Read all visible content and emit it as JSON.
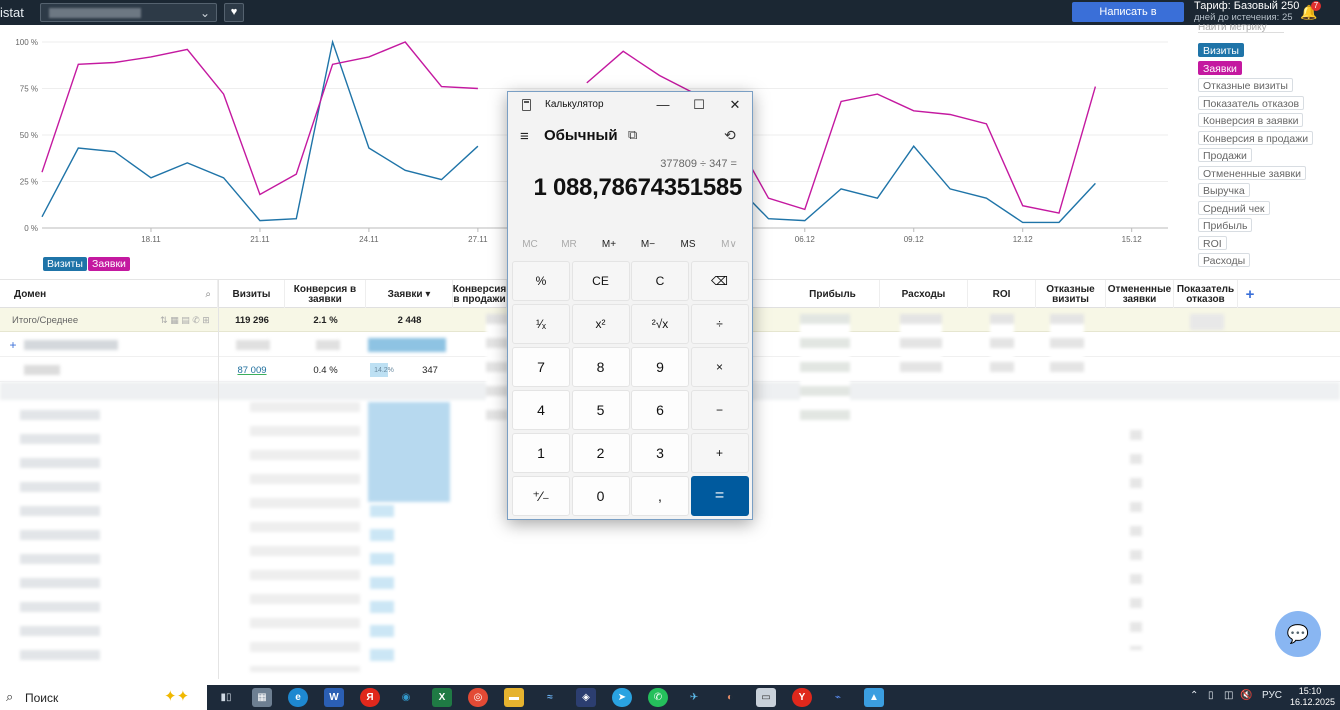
{
  "app": {
    "brand": "istat",
    "support_button": "Написать в поддержку",
    "tariff": "Тариф: Базовый 250",
    "days_left": "дней до истечения: 25",
    "notifications": "7"
  },
  "metrics": {
    "search_placeholder": "Найти метрику",
    "items": [
      "Визиты",
      "Заявки",
      "Отказные визиты",
      "Показатель отказов",
      "Конверсия в заявки",
      "Конверсия в продажи",
      "Продажи",
      "Отмененные заявки",
      "Выручка",
      "Средний чек",
      "Прибыль",
      "ROI",
      "Расходы"
    ],
    "active_colors": {
      "Визиты": "#1f74a8",
      "Заявки": "#c419a0"
    }
  },
  "chart_data": {
    "type": "line",
    "x": [
      "15.11",
      "16.11",
      "17.11",
      "18.11",
      "19.11",
      "20.11",
      "21.11",
      "22.11",
      "23.11",
      "24.11",
      "25.11",
      "26.11",
      "27.11",
      "28.11",
      "29.11",
      "30.11",
      "01.12",
      "02.12",
      "03.12",
      "04.12",
      "05.12",
      "06.12",
      "07.12",
      "08.12",
      "09.12",
      "10.12",
      "11.12",
      "12.12",
      "13.12",
      "14.12",
      "15.12",
      "16.12"
    ],
    "x_tick_labels": [
      "18.11",
      "21.11",
      "24.11",
      "27.11",
      "",
      "",
      "06.12",
      "09.12",
      "12.12",
      "15.12"
    ],
    "y_tick_labels": [
      "100 %",
      "75 %",
      "50 %",
      "25 %",
      "0 %"
    ],
    "ylim": [
      0,
      100
    ],
    "series": [
      {
        "name": "Визиты",
        "color": "#1f74a8",
        "values": [
          6,
          43,
          41,
          27,
          35,
          27,
          4,
          5,
          100,
          43,
          31,
          26,
          44,
          null,
          null,
          null,
          null,
          23,
          24,
          25,
          5,
          4,
          21,
          16,
          44,
          21,
          16,
          3,
          3,
          24,
          null,
          null
        ]
      },
      {
        "name": "Заявки",
        "color": "#c419a0",
        "values": [
          30,
          88,
          89,
          92,
          96,
          72,
          18,
          29,
          88,
          92,
          100,
          76,
          75,
          null,
          null,
          78,
          95,
          82,
          72,
          51,
          16,
          10,
          68,
          72,
          63,
          61,
          56,
          12,
          8,
          76,
          null,
          null
        ]
      }
    ],
    "legend": [
      "Визиты",
      "Заявки"
    ],
    "grid": true
  },
  "table": {
    "columns": [
      "Домен",
      "Визиты",
      "Конверсия в заявки",
      "Заявки ▾",
      "Конверсия в продажи",
      "Прибыль",
      "Расходы",
      "ROI",
      "Отказные визиты",
      "Отмененные заявки",
      "Показатель отказов"
    ],
    "totals": {
      "label": "Итого/Среднее",
      "visits": "119 296",
      "conv": "2.1 %",
      "leads": "2 448"
    },
    "row2": {
      "visits": "87 009",
      "conv": "0.4 %",
      "pct": "14.2%",
      "leads": "347"
    },
    "add_column": "+"
  },
  "calculator": {
    "title": "Калькулятор",
    "mode": "Обычный",
    "expression": "377809 ÷ 347 =",
    "display": "1 088,78674351585",
    "memory": [
      "MC",
      "MR",
      "M+",
      "M−",
      "MS",
      "M∨"
    ],
    "keys": [
      [
        "%",
        "CE",
        "C",
        "⌫"
      ],
      [
        "¹⁄ₓ",
        "x²",
        "²√x",
        "÷"
      ],
      [
        "7",
        "8",
        "9",
        "×"
      ],
      [
        "4",
        "5",
        "6",
        "−"
      ],
      [
        "1",
        "2",
        "3",
        "+"
      ],
      [
        "⁺⁄₋",
        "0",
        ",",
        "="
      ]
    ]
  },
  "taskbar": {
    "search": "Поиск",
    "lang": "РУС",
    "time": "15:10",
    "date": "16.12.2025"
  }
}
